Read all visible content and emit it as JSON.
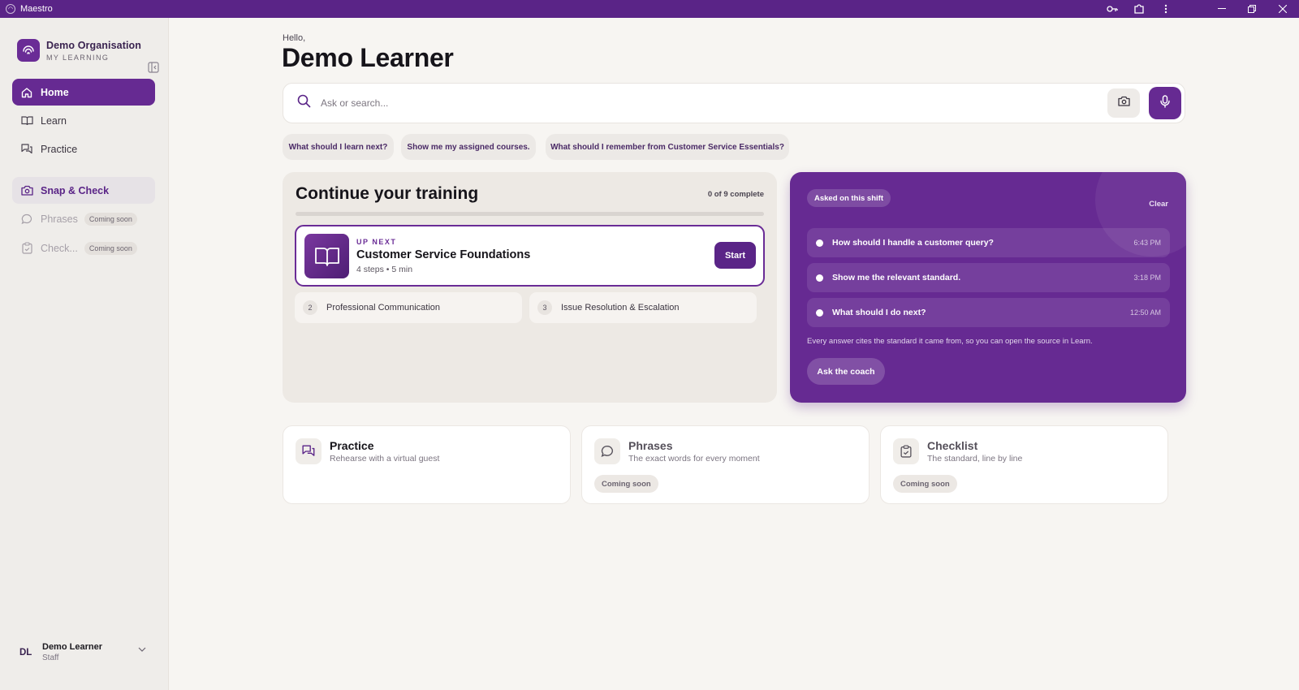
{
  "titlebar": {
    "app_name": "Maestro"
  },
  "colors": {
    "brand": "#5a2487",
    "accent": "#662a92",
    "background": "#f7f5f2"
  },
  "sidebar": {
    "org_name": "Demo Organisation",
    "org_section": "MY LEARNING",
    "items": [
      {
        "label": "Home",
        "icon": "home-icon"
      },
      {
        "label": "Learn",
        "icon": "book-icon"
      },
      {
        "label": "Practice",
        "icon": "chat-bubbles-icon"
      },
      {
        "label": "Snap & Check",
        "icon": "camera-icon"
      },
      {
        "label": "Phrases",
        "icon": "speech-bubble-icon",
        "badge": "Coming soon"
      },
      {
        "label": "Check...",
        "icon": "clipboard-icon",
        "badge": "Coming soon"
      }
    ],
    "user": {
      "initials": "DL",
      "name": "Demo Learner",
      "role": "Staff"
    }
  },
  "header": {
    "greeting": "Hello,",
    "name": "Demo Learner"
  },
  "search": {
    "placeholder": "Ask or search..."
  },
  "suggestions": [
    "What should I learn next?",
    "Show me my assigned courses.",
    "What should I remember from Customer Service Essentials?"
  ],
  "training": {
    "title": "Continue your training",
    "progress_text": "0 of 9 complete",
    "progress_fraction": 0,
    "up_next": {
      "label": "UP NEXT",
      "title": "Customer Service Foundations",
      "meta": "4 steps • 5 min",
      "start_label": "Start"
    },
    "steps": [
      {
        "num": "2",
        "title": "Professional Communication"
      },
      {
        "num": "3",
        "title": "Issue Resolution & Escalation"
      }
    ]
  },
  "coach": {
    "pill": "Asked on this shift",
    "clear_label": "Clear",
    "questions": [
      {
        "text": "How should I handle a customer query?",
        "time": "6:43 PM"
      },
      {
        "text": "Show me the relevant standard.",
        "time": "3:18 PM"
      },
      {
        "text": "What should I do next?",
        "time": "12:50 AM"
      }
    ],
    "note": "Every answer cites the standard it came from, so you can open the source in Learn.",
    "ask_label": "Ask the coach"
  },
  "cards": [
    {
      "title": "Practice",
      "subtitle": "Rehearse with a virtual guest",
      "icon": "chat-bubbles-icon"
    },
    {
      "title": "Phrases",
      "subtitle": "The exact words for every moment",
      "icon": "speech-bubble-icon",
      "badge": "Coming soon"
    },
    {
      "title": "Checklist",
      "subtitle": "The standard, line by line",
      "icon": "clipboard-icon",
      "badge": "Coming soon"
    }
  ]
}
